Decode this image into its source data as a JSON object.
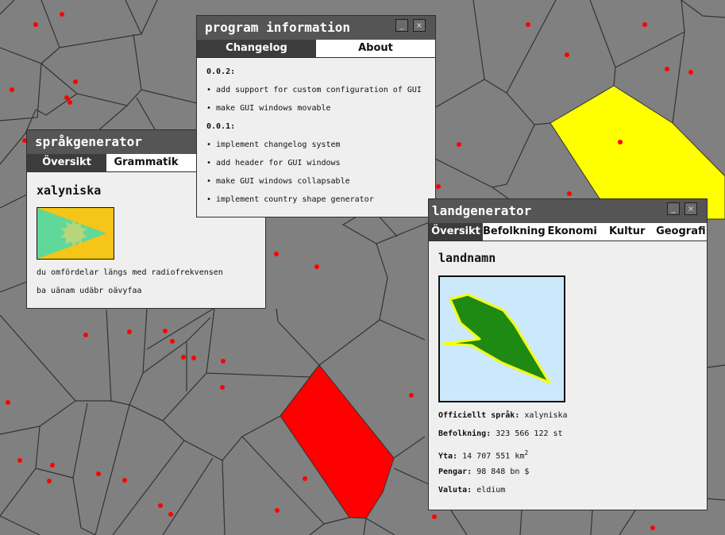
{
  "colors": {
    "background": "#808080",
    "cell_border": "#333333",
    "city_dot": "#ff0000",
    "highlight_yellow": "#ffff00",
    "highlight_red": "#ff0000",
    "titlebar": "#555555",
    "active_tab": "#3c3c3c",
    "window_body": "#efefef",
    "flag_orange": "#f5c518",
    "flag_green": "#5fd89a",
    "flag_sun": "#b5d67a",
    "shape_sea": "#cce8fb",
    "shape_land": "#1e8a14",
    "shape_coast": "#f4ff14"
  },
  "program_info": {
    "title": "program information",
    "tabs": [
      "Changelog",
      "About"
    ],
    "minimize_label": "_",
    "close_label": "×",
    "changelog": [
      {
        "version": "0.0.2:",
        "items": [
          "• add support for custom configuration of GUI",
          "• make GUI windows movable"
        ]
      },
      {
        "version": "0.0.1:",
        "items": [
          "• implement changelog system",
          "• add header for GUI windows",
          "• make GUI windows collapsable",
          "• implement country shape generator"
        ]
      }
    ]
  },
  "language_gen": {
    "title": "språkgenerator",
    "tabs": [
      "Översikt",
      "Grammatik",
      ""
    ],
    "language_name": "xalyniska",
    "flag_icon": "flag-triangle-sun",
    "sentences": [
      "du omfördelar längs med radiofrekvensen",
      "ba uänam udäbr oävyfaa"
    ]
  },
  "country_gen": {
    "title": "landgenerator",
    "tabs": [
      "Översikt",
      "Befolkning",
      "Ekonomi",
      "Kultur",
      "Geografi"
    ],
    "minimize_label": "_",
    "close_label": "×",
    "country_name": "landnamn",
    "shape_icon": "country-shape",
    "stats": [
      {
        "label": "Officiellt språk:",
        "value": "xalyniska"
      },
      {
        "label": "Befolkning:",
        "value": "323 566 122 st"
      },
      {
        "label": "Yta:",
        "value": "14 707 551 km",
        "sup": "2"
      },
      {
        "label": "Pengar:",
        "value": "98 848 bn $"
      },
      {
        "label": "Valuta:",
        "value": "eldium"
      }
    ]
  }
}
